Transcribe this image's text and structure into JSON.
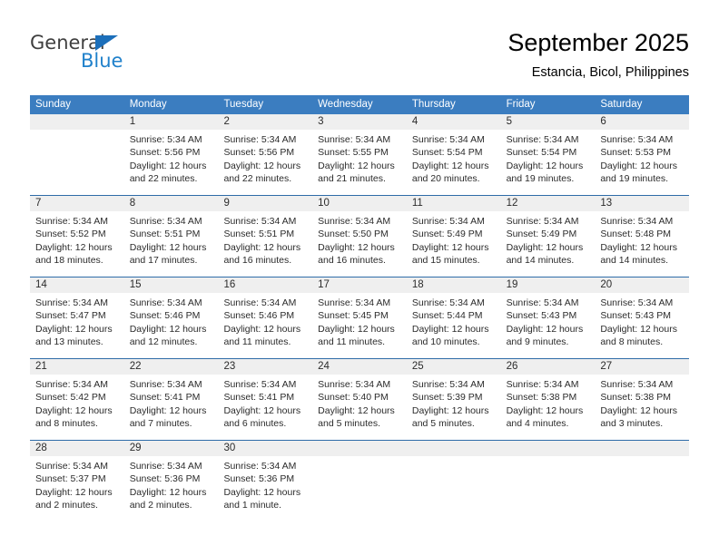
{
  "logo": {
    "word_general": "General",
    "word_blue": "Blue",
    "triangle_color": "#1c6fba",
    "blue_color": "#2081cb"
  },
  "header": {
    "month_title": "September 2025",
    "location": "Estancia, Bicol, Philippines"
  },
  "colors": {
    "header_row_bg": "#3b7dc0",
    "day_number_bg": "#efefef",
    "week_divider": "#2e6ca8",
    "text": "#2b2b2b"
  },
  "weekdays": [
    "Sunday",
    "Monday",
    "Tuesday",
    "Wednesday",
    "Thursday",
    "Friday",
    "Saturday"
  ],
  "weeks": [
    {
      "days": [
        {
          "num": "",
          "sunrise": "",
          "sunset": "",
          "daylight1": "",
          "daylight2": "",
          "empty": true
        },
        {
          "num": "1",
          "sunrise": "Sunrise: 5:34 AM",
          "sunset": "Sunset: 5:56 PM",
          "daylight1": "Daylight: 12 hours",
          "daylight2": "and 22 minutes.",
          "empty": false
        },
        {
          "num": "2",
          "sunrise": "Sunrise: 5:34 AM",
          "sunset": "Sunset: 5:56 PM",
          "daylight1": "Daylight: 12 hours",
          "daylight2": "and 22 minutes.",
          "empty": false
        },
        {
          "num": "3",
          "sunrise": "Sunrise: 5:34 AM",
          "sunset": "Sunset: 5:55 PM",
          "daylight1": "Daylight: 12 hours",
          "daylight2": "and 21 minutes.",
          "empty": false
        },
        {
          "num": "4",
          "sunrise": "Sunrise: 5:34 AM",
          "sunset": "Sunset: 5:54 PM",
          "daylight1": "Daylight: 12 hours",
          "daylight2": "and 20 minutes.",
          "empty": false
        },
        {
          "num": "5",
          "sunrise": "Sunrise: 5:34 AM",
          "sunset": "Sunset: 5:54 PM",
          "daylight1": "Daylight: 12 hours",
          "daylight2": "and 19 minutes.",
          "empty": false
        },
        {
          "num": "6",
          "sunrise": "Sunrise: 5:34 AM",
          "sunset": "Sunset: 5:53 PM",
          "daylight1": "Daylight: 12 hours",
          "daylight2": "and 19 minutes.",
          "empty": false
        }
      ]
    },
    {
      "days": [
        {
          "num": "7",
          "sunrise": "Sunrise: 5:34 AM",
          "sunset": "Sunset: 5:52 PM",
          "daylight1": "Daylight: 12 hours",
          "daylight2": "and 18 minutes.",
          "empty": false
        },
        {
          "num": "8",
          "sunrise": "Sunrise: 5:34 AM",
          "sunset": "Sunset: 5:51 PM",
          "daylight1": "Daylight: 12 hours",
          "daylight2": "and 17 minutes.",
          "empty": false
        },
        {
          "num": "9",
          "sunrise": "Sunrise: 5:34 AM",
          "sunset": "Sunset: 5:51 PM",
          "daylight1": "Daylight: 12 hours",
          "daylight2": "and 16 minutes.",
          "empty": false
        },
        {
          "num": "10",
          "sunrise": "Sunrise: 5:34 AM",
          "sunset": "Sunset: 5:50 PM",
          "daylight1": "Daylight: 12 hours",
          "daylight2": "and 16 minutes.",
          "empty": false
        },
        {
          "num": "11",
          "sunrise": "Sunrise: 5:34 AM",
          "sunset": "Sunset: 5:49 PM",
          "daylight1": "Daylight: 12 hours",
          "daylight2": "and 15 minutes.",
          "empty": false
        },
        {
          "num": "12",
          "sunrise": "Sunrise: 5:34 AM",
          "sunset": "Sunset: 5:49 PM",
          "daylight1": "Daylight: 12 hours",
          "daylight2": "and 14 minutes.",
          "empty": false
        },
        {
          "num": "13",
          "sunrise": "Sunrise: 5:34 AM",
          "sunset": "Sunset: 5:48 PM",
          "daylight1": "Daylight: 12 hours",
          "daylight2": "and 14 minutes.",
          "empty": false
        }
      ]
    },
    {
      "days": [
        {
          "num": "14",
          "sunrise": "Sunrise: 5:34 AM",
          "sunset": "Sunset: 5:47 PM",
          "daylight1": "Daylight: 12 hours",
          "daylight2": "and 13 minutes.",
          "empty": false
        },
        {
          "num": "15",
          "sunrise": "Sunrise: 5:34 AM",
          "sunset": "Sunset: 5:46 PM",
          "daylight1": "Daylight: 12 hours",
          "daylight2": "and 12 minutes.",
          "empty": false
        },
        {
          "num": "16",
          "sunrise": "Sunrise: 5:34 AM",
          "sunset": "Sunset: 5:46 PM",
          "daylight1": "Daylight: 12 hours",
          "daylight2": "and 11 minutes.",
          "empty": false
        },
        {
          "num": "17",
          "sunrise": "Sunrise: 5:34 AM",
          "sunset": "Sunset: 5:45 PM",
          "daylight1": "Daylight: 12 hours",
          "daylight2": "and 11 minutes.",
          "empty": false
        },
        {
          "num": "18",
          "sunrise": "Sunrise: 5:34 AM",
          "sunset": "Sunset: 5:44 PM",
          "daylight1": "Daylight: 12 hours",
          "daylight2": "and 10 minutes.",
          "empty": false
        },
        {
          "num": "19",
          "sunrise": "Sunrise: 5:34 AM",
          "sunset": "Sunset: 5:43 PM",
          "daylight1": "Daylight: 12 hours",
          "daylight2": "and 9 minutes.",
          "empty": false
        },
        {
          "num": "20",
          "sunrise": "Sunrise: 5:34 AM",
          "sunset": "Sunset: 5:43 PM",
          "daylight1": "Daylight: 12 hours",
          "daylight2": "and 8 minutes.",
          "empty": false
        }
      ]
    },
    {
      "days": [
        {
          "num": "21",
          "sunrise": "Sunrise: 5:34 AM",
          "sunset": "Sunset: 5:42 PM",
          "daylight1": "Daylight: 12 hours",
          "daylight2": "and 8 minutes.",
          "empty": false
        },
        {
          "num": "22",
          "sunrise": "Sunrise: 5:34 AM",
          "sunset": "Sunset: 5:41 PM",
          "daylight1": "Daylight: 12 hours",
          "daylight2": "and 7 minutes.",
          "empty": false
        },
        {
          "num": "23",
          "sunrise": "Sunrise: 5:34 AM",
          "sunset": "Sunset: 5:41 PM",
          "daylight1": "Daylight: 12 hours",
          "daylight2": "and 6 minutes.",
          "empty": false
        },
        {
          "num": "24",
          "sunrise": "Sunrise: 5:34 AM",
          "sunset": "Sunset: 5:40 PM",
          "daylight1": "Daylight: 12 hours",
          "daylight2": "and 5 minutes.",
          "empty": false
        },
        {
          "num": "25",
          "sunrise": "Sunrise: 5:34 AM",
          "sunset": "Sunset: 5:39 PM",
          "daylight1": "Daylight: 12 hours",
          "daylight2": "and 5 minutes.",
          "empty": false
        },
        {
          "num": "26",
          "sunrise": "Sunrise: 5:34 AM",
          "sunset": "Sunset: 5:38 PM",
          "daylight1": "Daylight: 12 hours",
          "daylight2": "and 4 minutes.",
          "empty": false
        },
        {
          "num": "27",
          "sunrise": "Sunrise: 5:34 AM",
          "sunset": "Sunset: 5:38 PM",
          "daylight1": "Daylight: 12 hours",
          "daylight2": "and 3 minutes.",
          "empty": false
        }
      ]
    },
    {
      "days": [
        {
          "num": "28",
          "sunrise": "Sunrise: 5:34 AM",
          "sunset": "Sunset: 5:37 PM",
          "daylight1": "Daylight: 12 hours",
          "daylight2": "and 2 minutes.",
          "empty": false
        },
        {
          "num": "29",
          "sunrise": "Sunrise: 5:34 AM",
          "sunset": "Sunset: 5:36 PM",
          "daylight1": "Daylight: 12 hours",
          "daylight2": "and 2 minutes.",
          "empty": false
        },
        {
          "num": "30",
          "sunrise": "Sunrise: 5:34 AM",
          "sunset": "Sunset: 5:36 PM",
          "daylight1": "Daylight: 12 hours",
          "daylight2": "and 1 minute.",
          "empty": false
        },
        {
          "num": "",
          "sunrise": "",
          "sunset": "",
          "daylight1": "",
          "daylight2": "",
          "empty": true
        },
        {
          "num": "",
          "sunrise": "",
          "sunset": "",
          "daylight1": "",
          "daylight2": "",
          "empty": true
        },
        {
          "num": "",
          "sunrise": "",
          "sunset": "",
          "daylight1": "",
          "daylight2": "",
          "empty": true
        },
        {
          "num": "",
          "sunrise": "",
          "sunset": "",
          "daylight1": "",
          "daylight2": "",
          "empty": true
        }
      ]
    }
  ]
}
